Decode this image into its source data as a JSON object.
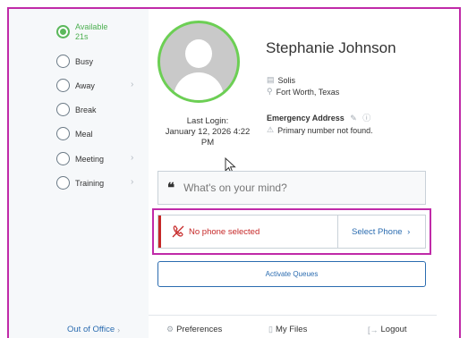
{
  "status": {
    "items": [
      {
        "label": "Available",
        "sub": "21s",
        "selected": true,
        "submenu": false
      },
      {
        "label": "Busy",
        "selected": false,
        "submenu": false
      },
      {
        "label": "Away",
        "selected": false,
        "submenu": true
      },
      {
        "label": "Break",
        "selected": false,
        "submenu": false
      },
      {
        "label": "Meal",
        "selected": false,
        "submenu": false
      },
      {
        "label": "Meeting",
        "selected": false,
        "submenu": true
      },
      {
        "label": "Training",
        "selected": false,
        "submenu": true
      }
    ]
  },
  "profile": {
    "name": "Stephanie Johnson",
    "company": "Solis",
    "location": "Fort Worth, Texas",
    "last_login_label": "Last Login:",
    "last_login_value": "January 12, 2026 4:22 PM",
    "emergency_title": "Emergency Address",
    "emergency_text": "Primary number not found."
  },
  "composer": {
    "placeholder": "What's on your mind?"
  },
  "phone": {
    "status_text": "No phone selected",
    "select_label": "Select Phone",
    "status_color": "#c62828",
    "link_color": "#2b6cb0"
  },
  "queues": {
    "activate_label": "Activate Queues"
  },
  "footer": {
    "out_of_office": "Out of Office",
    "preferences": "Preferences",
    "my_files": "My Files",
    "logout": "Logout"
  },
  "colors": {
    "available_green": "#5cb85c",
    "highlight_magenta": "#c02aa8"
  }
}
